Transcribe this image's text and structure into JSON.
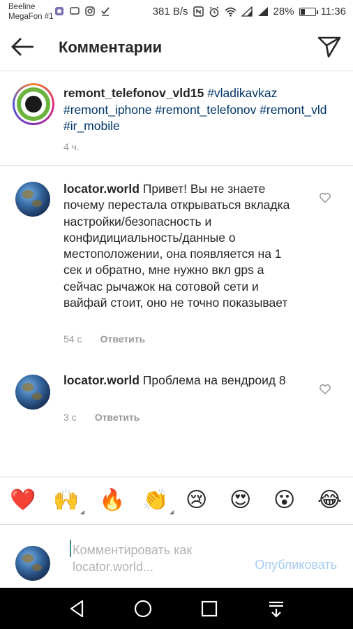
{
  "status_bar": {
    "carrier1": "Beeline",
    "carrier2": "MegaFon #1",
    "speed": "381 B/s",
    "battery": "28%",
    "time": "11:36",
    "battery_level": 0.28
  },
  "header": {
    "title": "Комментарии",
    "back_icon": "arrow-left-icon",
    "send_icon": "paper-plane-icon"
  },
  "caption": {
    "username": "remont_telefonov_vld15",
    "hashtags": [
      "#vladikavkaz",
      "#remont_iphone",
      "#remont_telefonov",
      "#remont_vld",
      "#ir_mobile"
    ],
    "time": "4 ч."
  },
  "comments": [
    {
      "username": "locator.world",
      "text": "Привет! Вы не знаете почему перестала открываться вкладка настройки/безопасность и конфидициальность/данные о местоположении, она появляется на 1 сек и обратно, мне нужно вкл gps а сейчас рычажок на сотовой сети и вайфай стоит, оно не точно показывает",
      "time": "54 с",
      "reply": "Ответить"
    },
    {
      "username": "locator.world",
      "text": "Проблема на вендроид 8",
      "time": "3 с",
      "reply": "Ответить"
    }
  ],
  "emoji_bar": [
    "❤️",
    "🙌",
    "🔥",
    "👏",
    "😢",
    "😍",
    "😮",
    "😂"
  ],
  "composer": {
    "placeholder_line1": "Комментировать как",
    "placeholder_line2": "locator.world...",
    "publish": "Опубликовать"
  }
}
